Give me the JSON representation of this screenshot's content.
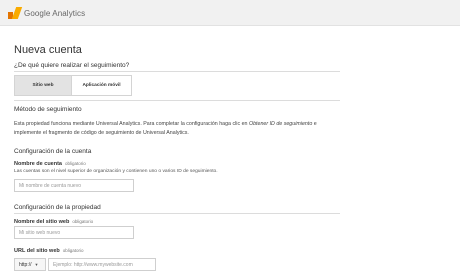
{
  "app": {
    "logo_text": "Google Analytics"
  },
  "header": {
    "title": "Nueva cuenta"
  },
  "tracking": {
    "question": "¿De qué quiere realizar el seguimiento?",
    "tabs": [
      {
        "label": "Sitio web",
        "selected": true
      },
      {
        "label": "Aplicación móvil",
        "selected": false
      }
    ]
  },
  "method": {
    "heading": "Método de seguimiento",
    "desc_part1": "Esta propiedad funciona mediante Universal Analytics. Para completar la configuración haga clic en ",
    "desc_em": "Obtener ID de seguimiento",
    "desc_part2": " e implemente el fragmento de código de seguimiento de Universal Analytics."
  },
  "account": {
    "heading": "Configuración de la cuenta",
    "name_label": "Nombre de cuenta",
    "required": "obligatorio",
    "help": "Las cuentas son el nivel superior de organización y contienen uno o varios ID de seguimiento.",
    "placeholder": "Mi nombre de cuenta nuevo"
  },
  "property": {
    "heading": "Configuración de la propiedad",
    "site_label": "Nombre del sitio web",
    "site_required": "obligatorio",
    "site_placeholder": "Mi sitio web nuevo",
    "url_label": "URL del sitio web",
    "url_required": "obligatorio",
    "protocol": "http://",
    "url_placeholder": "Ejemplo: http://www.mywebsite.com"
  }
}
